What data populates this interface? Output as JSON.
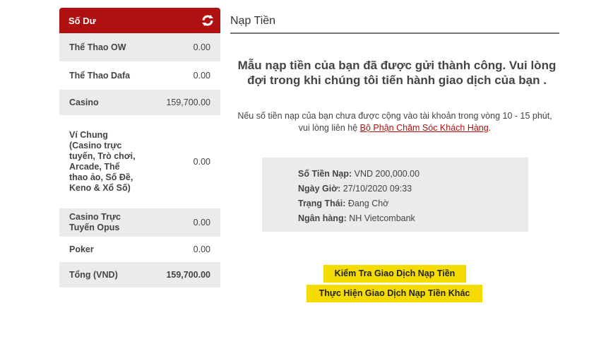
{
  "balance": {
    "title": "Số Dư",
    "rows": [
      {
        "label": "Thể Thao OW",
        "amount": "0.00"
      },
      {
        "label": "Thể Thao Dafa",
        "amount": "0.00"
      },
      {
        "label": "Casino",
        "amount": "159,700.00"
      },
      {
        "label": "Ví Chung (Casino trực tuyến, Trò chơi, Arcade, Thể thao ảo, Số Đề, Keno & Xổ Số)",
        "amount": "0.00"
      },
      {
        "label": "Casino Trực Tuyến Opus",
        "amount": "0.00"
      },
      {
        "label": "Poker",
        "amount": "0.00"
      }
    ],
    "total": {
      "label": "Tổng (VND)",
      "amount": "159,700.00"
    }
  },
  "deposit": {
    "title": "Nạp Tiền",
    "success_message": "Mẫu nạp tiền của bạn đã được gửi thành công. Vui lòng đợi trong khi chúng tôi tiến hành giao dịch của bạn .",
    "notice_text": "Nếu số tiền nạp của bạn chưa được cộng vào tài khoản trong vòng 10 - 15 phút, vui lòng liên hệ ",
    "notice_link": "Bộ Phận Chăm Sóc Khách Hàng",
    "notice_end": ".",
    "details": {
      "amount_label": "Số Tiền Nạp:",
      "amount_value": "VND 200,000.00",
      "datetime_label": "Ngày Giờ:",
      "datetime_value": "27/10/2020 09:33",
      "status_label": "Trạng Thái:",
      "status_value": "Đang Chờ",
      "bank_label": "Ngân hàng:",
      "bank_value": "NH Vietcombank"
    },
    "check_button": "Kiểm Tra Giao Dịch Nạp Tiền",
    "new_deposit_button": "Thực Hiện Giao Dịch Nạp Tiền Khác"
  },
  "colors": {
    "header_red": "#b01010",
    "button_yellow": "#f5dc00",
    "panel_gray": "#ebebeb"
  }
}
